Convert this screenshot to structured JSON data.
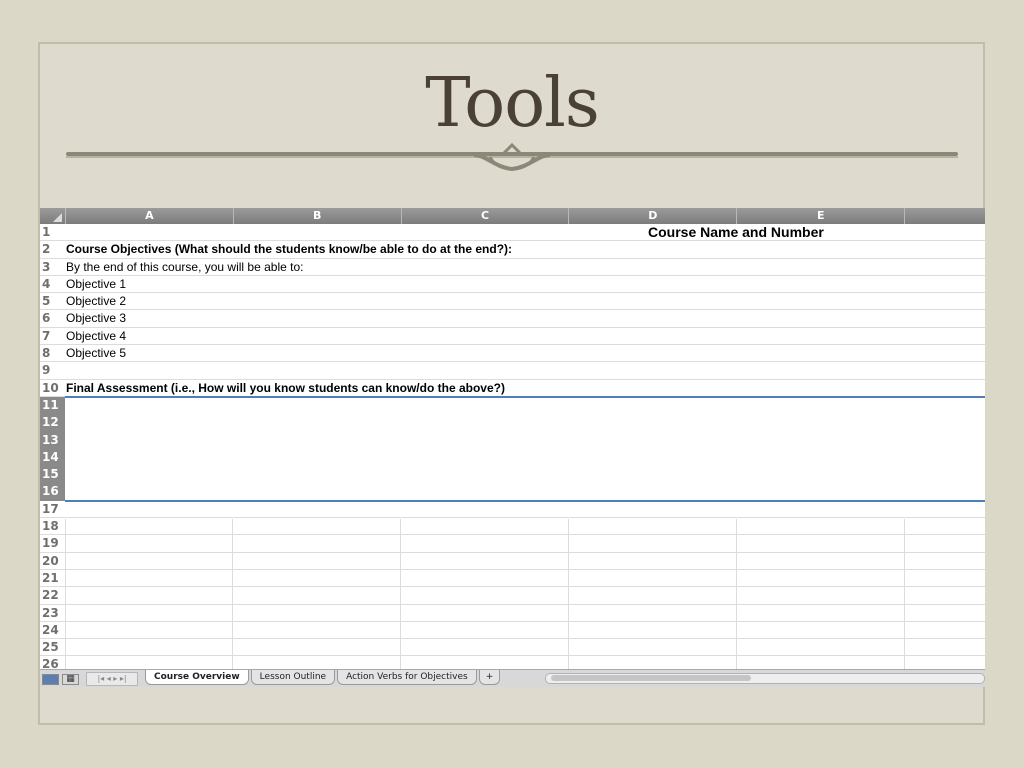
{
  "slide": {
    "title": "Tools"
  },
  "sheet": {
    "columns": [
      "A",
      "B",
      "C",
      "D",
      "E",
      ""
    ],
    "rows": [
      {
        "num": "1",
        "text": "Course Name and Number",
        "style": "title"
      },
      {
        "num": "2",
        "text": "Course Objectives (What should the students know/be able to do at the end?):",
        "style": "bold"
      },
      {
        "num": "3",
        "text": "By the end of this course, you will be able to:",
        "style": "normal"
      },
      {
        "num": "4",
        "text": "Objective 1",
        "style": "normal"
      },
      {
        "num": "5",
        "text": "Objective 2",
        "style": "normal"
      },
      {
        "num": "6",
        "text": "Objective 3",
        "style": "normal"
      },
      {
        "num": "7",
        "text": "Objective 4",
        "style": "normal"
      },
      {
        "num": "8",
        "text": "Objective 5",
        "style": "normal"
      },
      {
        "num": "9",
        "text": "",
        "style": "normal"
      },
      {
        "num": "10",
        "text": "Final Assessment (i.e., How will you know students can know/do the above?)",
        "style": "bold"
      },
      {
        "num": "11",
        "text": "",
        "style": "merged"
      },
      {
        "num": "12",
        "text": "",
        "style": "merged"
      },
      {
        "num": "13",
        "text": "",
        "style": "merged"
      },
      {
        "num": "14",
        "text": "",
        "style": "merged"
      },
      {
        "num": "15",
        "text": "",
        "style": "merged"
      },
      {
        "num": "16",
        "text": "",
        "style": "merged"
      },
      {
        "num": "17",
        "text": "",
        "style": "normal"
      },
      {
        "num": "18",
        "text": "",
        "style": "normal"
      },
      {
        "num": "19",
        "text": "",
        "style": "normal"
      },
      {
        "num": "20",
        "text": "",
        "style": "normal"
      },
      {
        "num": "21",
        "text": "",
        "style": "normal"
      },
      {
        "num": "22",
        "text": "",
        "style": "normal"
      },
      {
        "num": "23",
        "text": "",
        "style": "normal"
      },
      {
        "num": "24",
        "text": "",
        "style": "normal"
      },
      {
        "num": "25",
        "text": "",
        "style": "normal"
      },
      {
        "num": "26",
        "text": "",
        "style": "normal"
      }
    ],
    "tabs": [
      {
        "label": "Course Overview",
        "active": true
      },
      {
        "label": "Lesson Outline",
        "active": false
      },
      {
        "label": "Action Verbs for Objectives",
        "active": false
      },
      {
        "label": "+",
        "active": false
      }
    ],
    "nav_arrows": "|◂ ◂ ▸ ▸|"
  },
  "colors": {
    "background": "#dcd8c8",
    "title": "#4a4038",
    "selection": "#4f7fb8"
  }
}
